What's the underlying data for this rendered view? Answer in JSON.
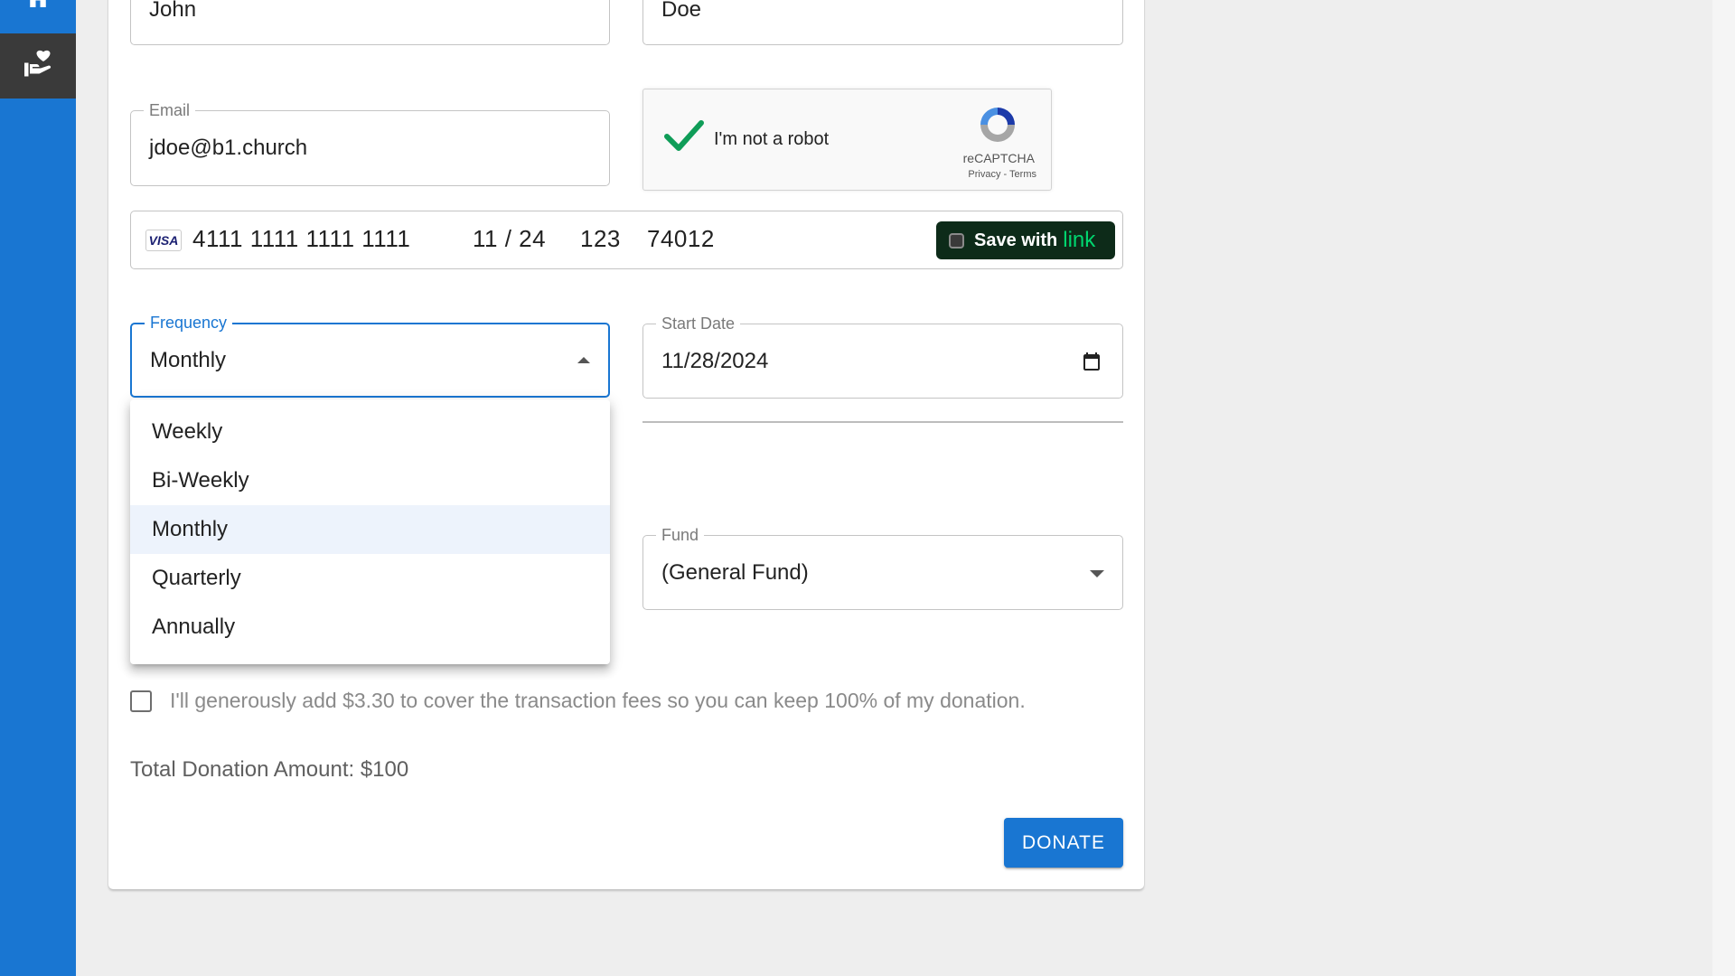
{
  "colors": {
    "primary": "#1976d2",
    "sidebar_active": "#3a3a3a",
    "link_green": "#00d66f",
    "link_bg": "#0d2b19",
    "captcha_check": "#0f9d58"
  },
  "sidebar": {
    "items": [
      {
        "icon": "home-icon",
        "active": false
      },
      {
        "icon": "donate-hand-heart-icon",
        "active": true
      }
    ]
  },
  "form": {
    "first_name": {
      "value": "John"
    },
    "last_name": {
      "value": "Doe"
    },
    "email": {
      "label": "Email",
      "value": "jdoe@b1.church"
    },
    "captcha": {
      "text": "I'm not a robot",
      "brand": "reCAPTCHA",
      "privacy": "Privacy",
      "separator": " - ",
      "terms": "Terms",
      "checked": true
    },
    "card": {
      "brand": "VISA",
      "number": "4111 1111 1111 1111",
      "expiry": "11 / 24",
      "cvc": "123",
      "zip": "74012",
      "save_prefix": "Save with",
      "save_brand": "link"
    },
    "frequency": {
      "label": "Frequency",
      "value": "Monthly",
      "options": [
        "Weekly",
        "Bi-Weekly",
        "Monthly",
        "Quarterly",
        "Annually"
      ],
      "selected_index": 2
    },
    "start_date": {
      "label": "Start Date",
      "value": "11/28/2024"
    },
    "fund": {
      "label": "Fund",
      "value": "(General Fund)"
    },
    "fees": {
      "checked": false,
      "text": "I'll generously add $3.30 to cover the transaction fees so you can keep 100% of my donation."
    },
    "total": "Total Donation Amount: $100",
    "donate_label": "DONATE"
  }
}
